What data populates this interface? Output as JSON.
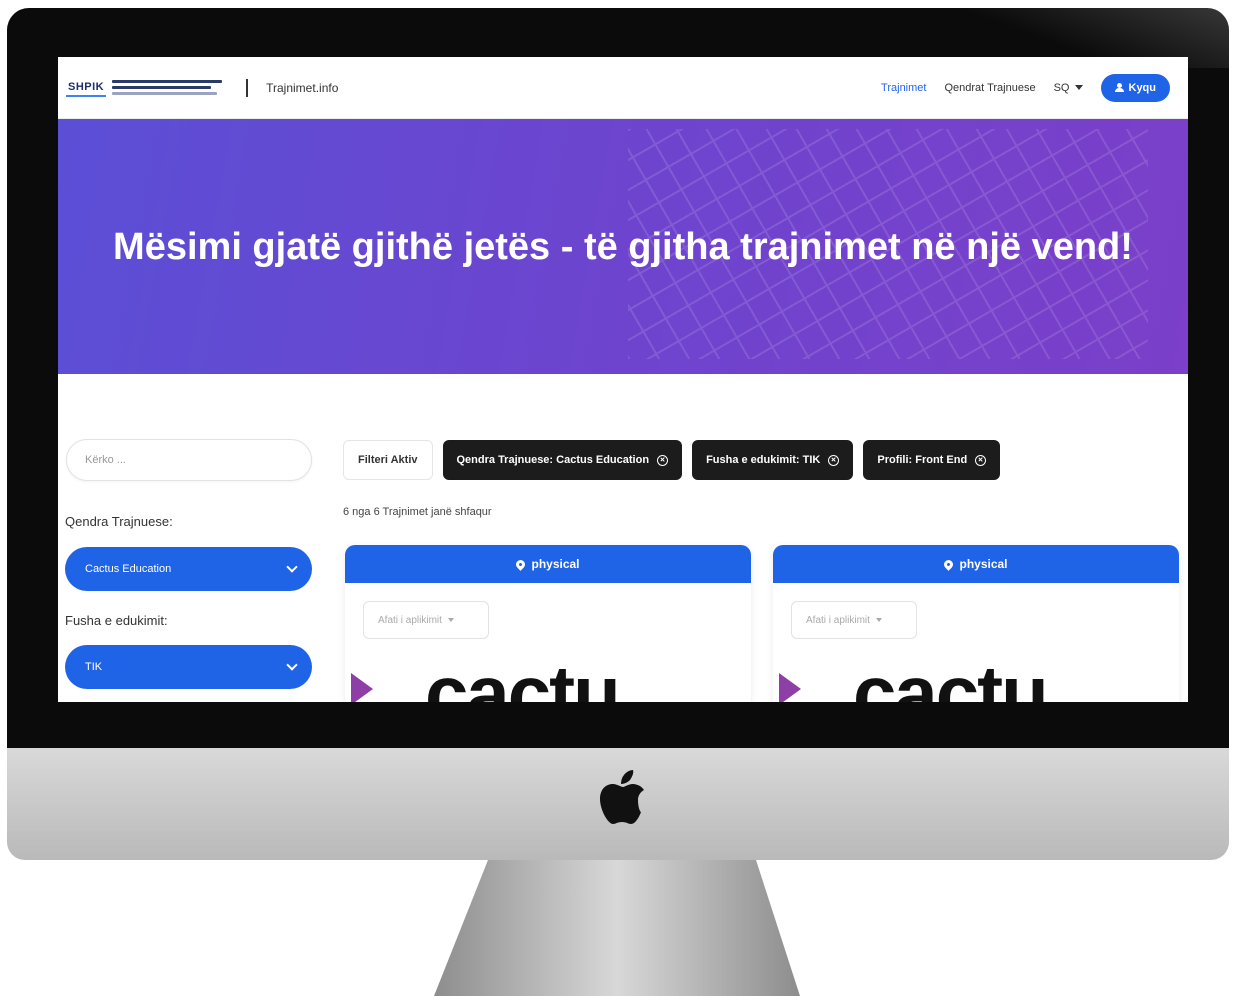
{
  "nav": {
    "brand_badge": "SHPIK",
    "site_name": "Trajnimet.info",
    "links": [
      "Trajnimet",
      "Qendrat Trajnuese"
    ],
    "language": "SQ",
    "login_label": "Kyqu"
  },
  "hero": {
    "title": "Mësimi gjatë gjithë jetës - të gjitha trajnimet në një vend!"
  },
  "sidebar": {
    "search_placeholder": "Kërko ...",
    "training_center_label": "Qendra Trajnuese:",
    "training_center_value": "Cactus Education",
    "field_label": "Fusha e edukimit:",
    "field_value": "TIK"
  },
  "filters": {
    "active_label": "Filteri Aktiv",
    "chips": [
      "Qendra Trajnuese: Cactus Education",
      "Fusha e edukimit: TIK",
      "Profili: Front End"
    ]
  },
  "results": {
    "count_text": "6 nga 6 Trajnimet janë shfaqur"
  },
  "cards": [
    {
      "mode": "physical",
      "dropdown": "Afati i aplikimit",
      "logo_text": "cactu"
    },
    {
      "mode": "physical",
      "dropdown": "Afati i aplikimit",
      "logo_text": "cactu"
    }
  ],
  "colors": {
    "accent": "#1f63e6",
    "hero_start": "#5b4fd6",
    "hero_end": "#7b3fc9",
    "chip_dark": "#1c1c1c"
  }
}
